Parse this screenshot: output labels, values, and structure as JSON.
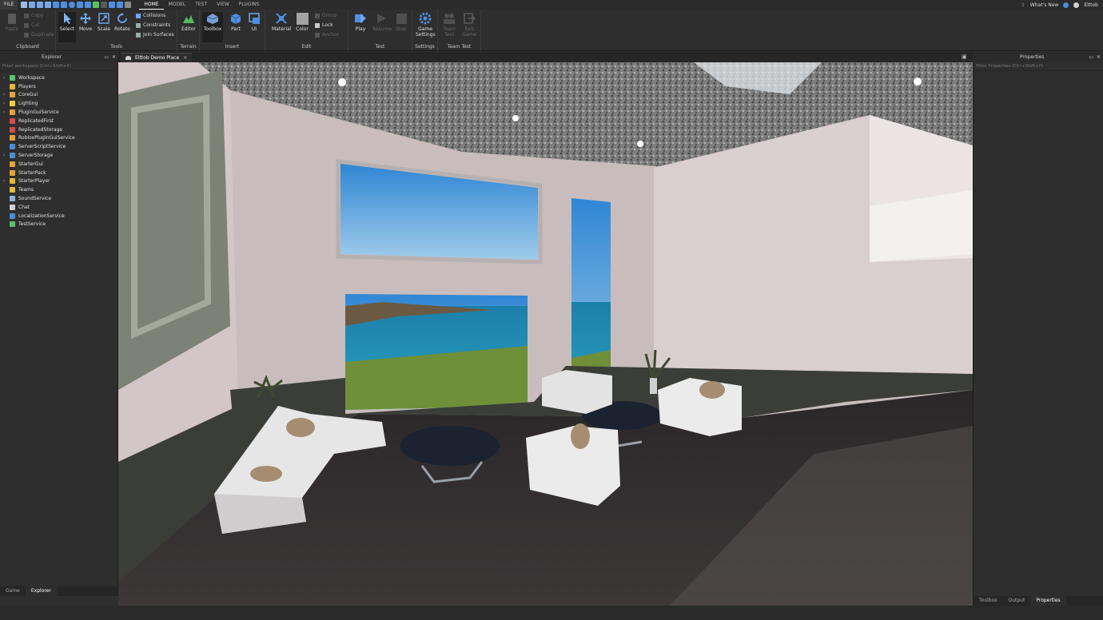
{
  "app": {
    "file_menu": "FILE",
    "menu_tabs": [
      "HOME",
      "MODEL",
      "TEST",
      "VIEW",
      "PLUGINS"
    ],
    "active_tab": "HOME",
    "whats_new": "What's New",
    "user": "Elttob"
  },
  "clipboard": {
    "paste": "Paste",
    "copy": "Copy",
    "cut": "Cut",
    "duplicate": "Duplicate",
    "label": "Clipboard"
  },
  "tools": {
    "select": "Select",
    "move": "Move",
    "scale": "Scale",
    "rotate": "Rotate",
    "collisions": "Collisions",
    "constraints": "Constraints",
    "join_surfaces": "Join Surfaces",
    "label": "Tools"
  },
  "terrain": {
    "editor": "Editor",
    "label": "Terrain"
  },
  "insert": {
    "toolbox": "Toolbox",
    "part": "Part",
    "ui": "UI",
    "label": "Insert"
  },
  "edit": {
    "material": "Material",
    "color": "Color",
    "group": "Group",
    "lock": "Lock",
    "anchor": "Anchor",
    "label": "Edit"
  },
  "test": {
    "play": "Play",
    "resume": "Resume",
    "stop": "Stop",
    "label": "Test"
  },
  "settings": {
    "game_settings": "Game Settings",
    "label": "Settings"
  },
  "team_test": {
    "team_test": "Team Test",
    "exit_game": "Exit Game",
    "label": "Team Test"
  },
  "explorer": {
    "title": "Explorer",
    "filter_placeholder": "Filter workspace (Ctrl+Shift+X)",
    "items": [
      {
        "label": "Workspace",
        "icon": "workspace-icon",
        "color": "#5cc46b",
        "expandable": true
      },
      {
        "label": "Players",
        "icon": "players-icon",
        "color": "#e4b73f",
        "expandable": false
      },
      {
        "label": "CoreGui",
        "icon": "coregui-icon",
        "color": "#e7a23a",
        "expandable": true
      },
      {
        "label": "Lighting",
        "icon": "lighting-icon",
        "color": "#f2d040",
        "expandable": true
      },
      {
        "label": "PluginGuiService",
        "icon": "pluginguiservice-icon",
        "color": "#e7a23a",
        "expandable": true
      },
      {
        "label": "ReplicatedFirst",
        "icon": "replicatedfirst-icon",
        "color": "#d64a4a",
        "expandable": false
      },
      {
        "label": "ReplicatedStorage",
        "icon": "replicatedstorage-icon",
        "color": "#d64a4a",
        "expandable": false
      },
      {
        "label": "RobloxPluginGuiService",
        "icon": "robloxpluginguiservice-icon",
        "color": "#e7a23a",
        "expandable": false
      },
      {
        "label": "ServerScriptService",
        "icon": "serverscriptservice-icon",
        "color": "#4a8fd6",
        "expandable": false
      },
      {
        "label": "ServerStorage",
        "icon": "serverstorage-icon",
        "color": "#4a8fd6",
        "expandable": true
      },
      {
        "label": "StarterGui",
        "icon": "startergui-icon",
        "color": "#e7a23a",
        "expandable": false
      },
      {
        "label": "StarterPack",
        "icon": "starterpack-icon",
        "color": "#e7a23a",
        "expandable": false
      },
      {
        "label": "StarterPlayer",
        "icon": "starterplayer-icon",
        "color": "#e4b73f",
        "expandable": true
      },
      {
        "label": "Teams",
        "icon": "teams-icon",
        "color": "#e4b73f",
        "expandable": false
      },
      {
        "label": "SoundService",
        "icon": "soundservice-icon",
        "color": "#8fb4d9",
        "expandable": false
      },
      {
        "label": "Chat",
        "icon": "chat-icon",
        "color": "#d0d0d0",
        "expandable": false
      },
      {
        "label": "LocalizationService",
        "icon": "localizationservice-icon",
        "color": "#4a8fd6",
        "expandable": false
      },
      {
        "label": "TestService",
        "icon": "testservice-icon",
        "color": "#5cc46b",
        "expandable": false
      }
    ],
    "bottom_tabs": [
      "Game",
      "Explorer"
    ]
  },
  "document": {
    "tab_title": "Elttob Demo Place"
  },
  "properties": {
    "title": "Properties",
    "filter_placeholder": "Filter Properties (Ctrl+Shift+P)",
    "bottom_tabs": [
      "Toolbox",
      "Output",
      "Properties"
    ]
  }
}
